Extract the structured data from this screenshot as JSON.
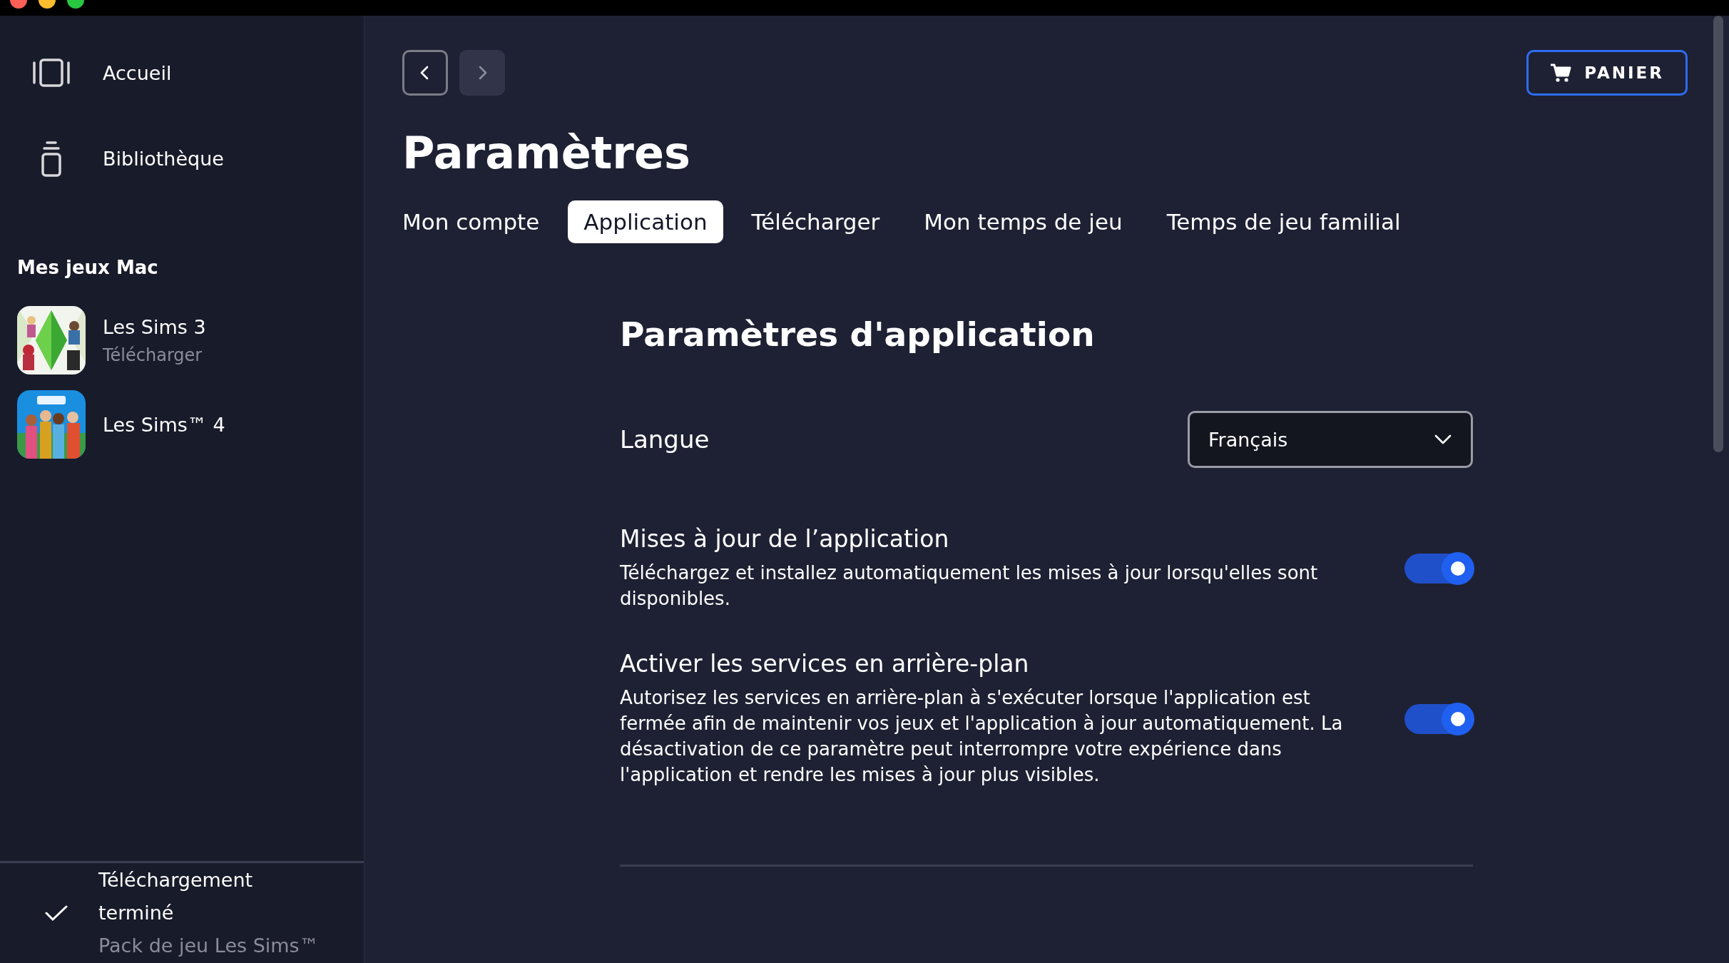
{
  "sidebar": {
    "nav": [
      {
        "label": "Accueil",
        "kind": "home"
      },
      {
        "label": "Bibliothèque",
        "kind": "library"
      }
    ],
    "section_title": "Mes jeux Mac",
    "games": [
      {
        "title": "Les Sims 3",
        "status": "Télécharger",
        "kind": "picture"
      },
      {
        "title": "Les Sims™ 4",
        "kind": "picture"
      }
    ],
    "notification": {
      "title": "Téléchargement terminé",
      "detail": "Pack de jeu Les Sims™"
    }
  },
  "history": [
    {
      "kind": "back",
      "disabled": false
    },
    {
      "kind": "forward",
      "disabled": true
    }
  ],
  "cart_button": "PANIER",
  "page_title": "Paramètres",
  "tabs": [
    {
      "label": "Mon compte",
      "selected": false
    },
    {
      "label": "Application",
      "selected": true
    },
    {
      "label": "Télécharger",
      "selected": false
    },
    {
      "label": "Mon temps de jeu",
      "selected": false
    },
    {
      "label": "Temps de jeu familial",
      "selected": false
    }
  ],
  "section": {
    "title": "Paramètres d'application",
    "language": {
      "label": "Langue",
      "value": "Français"
    },
    "settings": [
      {
        "title": "Mises à jour de l’application",
        "description": "Téléchargez et installez automatiquement les mises à jour lorsqu'elles sont disponibles.",
        "on": true
      },
      {
        "title": "Activer les services en arrière-plan",
        "description": "Autorisez les services en arrière-plan à s'exécuter lorsque l'application est fermée afin de maintenir vos jeux et l'application à jour automatiquement. La désactivation de ce paramètre peut interrompre votre expérience dans l'application et rendre les mises à jour plus visibles.",
        "on": true
      }
    ]
  }
}
